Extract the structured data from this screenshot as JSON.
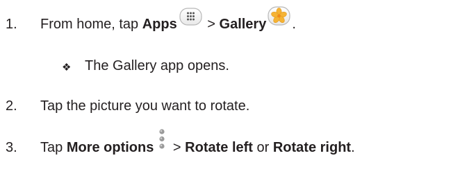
{
  "steps": [
    {
      "number": "1.",
      "prefix": "From home, tap ",
      "apps_label": "Apps",
      "separator": " > ",
      "gallery_label": "Gallery",
      "suffix": "."
    },
    {
      "bullet": "❖",
      "text": "The Gallery app opens."
    },
    {
      "number": "2.",
      "text": "Tap the picture you want to rotate."
    },
    {
      "number": "3.",
      "prefix": "Tap ",
      "more_options_label": "More options",
      "separator": " > ",
      "rotate_left_label": "Rotate left",
      "or_text": " or ",
      "rotate_right_label": "Rotate right",
      "suffix": "."
    }
  ],
  "icons": {
    "apps": "apps-grid-icon",
    "gallery": "gallery-flower-icon",
    "more_options": "more-options-vertical-dots-icon"
  },
  "colors": {
    "text": "#231f20",
    "gallery_flower": "#f5b335",
    "icon_border": "#b8b8b8"
  }
}
